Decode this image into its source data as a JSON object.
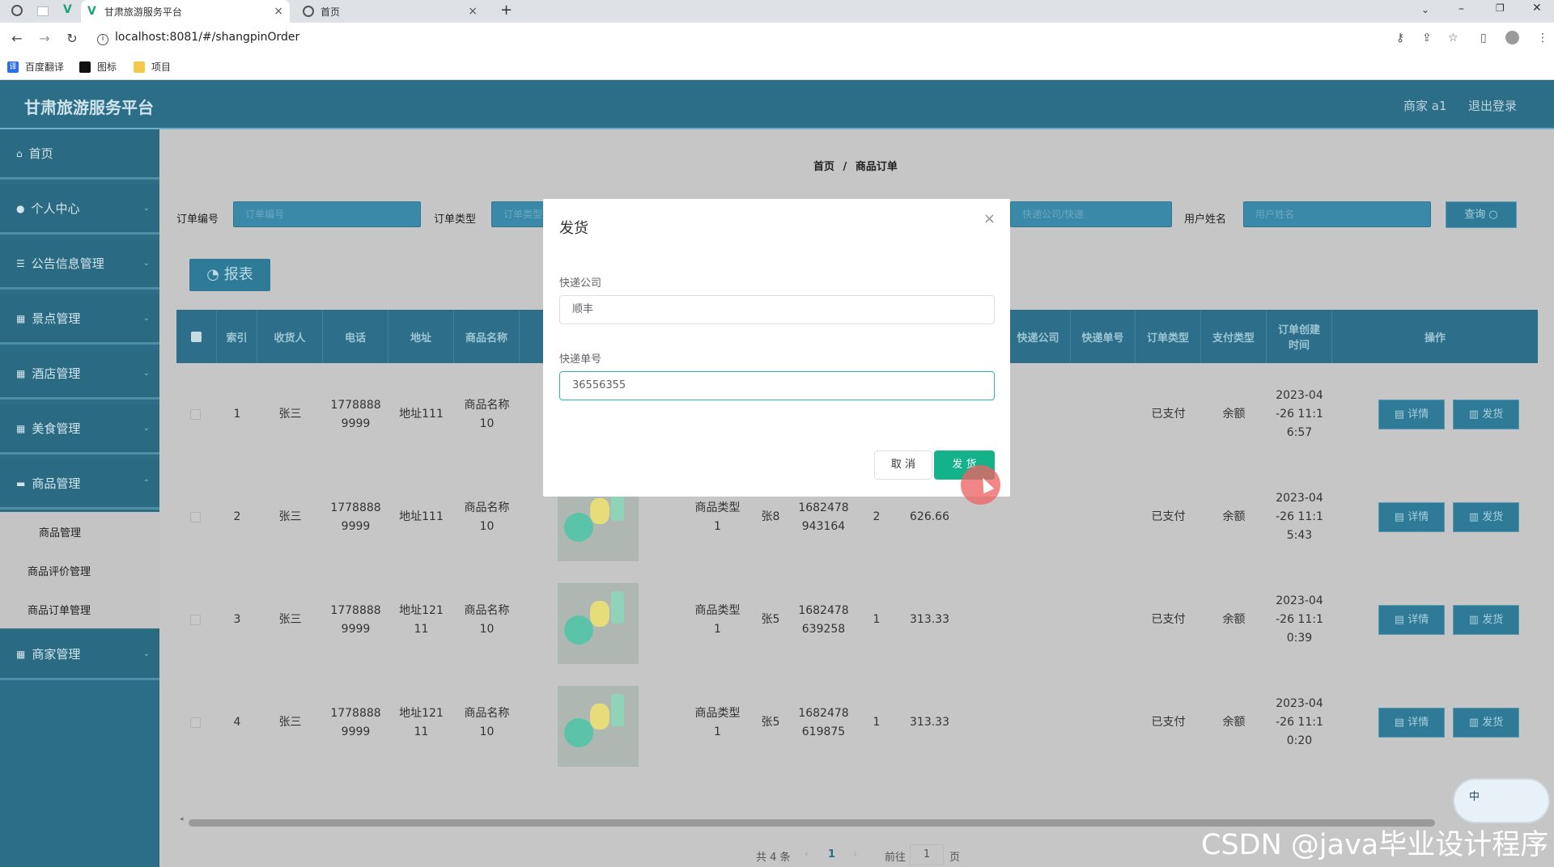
{
  "browser": {
    "tabs": [
      {
        "title": "甘肃旅游服务平台",
        "close": "×"
      },
      {
        "title": "首页",
        "close": "×"
      }
    ],
    "new_tab": "+",
    "url": "localhost:8081/#/shangpinOrder",
    "bookmarks": [
      "百度翻译",
      "图标",
      "项目"
    ]
  },
  "header": {
    "title": "甘肃旅游服务平台",
    "user": "商家 a1",
    "logout": "退出登录"
  },
  "sidebar": {
    "items": [
      {
        "label": "首页",
        "icon": "home-icon"
      },
      {
        "label": "个人中心",
        "icon": "user-icon"
      },
      {
        "label": "公告信息管理",
        "icon": "list-icon"
      },
      {
        "label": "景点管理",
        "icon": "grid-icon"
      },
      {
        "label": "酒店管理",
        "icon": "grid-icon"
      },
      {
        "label": "美食管理",
        "icon": "grid-icon"
      },
      {
        "label": "商品管理",
        "icon": "message-icon"
      }
    ],
    "sub_items": [
      "商品管理",
      "商品评价管理",
      "商品订单管理"
    ],
    "last_item": {
      "label": "商家管理",
      "icon": "grid-icon"
    }
  },
  "main": {
    "breadcrumb": {
      "home": "首页",
      "sep": "/",
      "current": "商品订单"
    },
    "filters": {
      "order_no_label": "订单编号",
      "order_no_placeholder": "订单编号",
      "order_type_label": "订单类型",
      "order_type_placeholder": "订单类型",
      "middle_placeholder": "快递公司/快递",
      "user_name_label": "用户姓名",
      "user_name_placeholder": "用户姓名",
      "query": "查询"
    },
    "report_button": "报表",
    "table": {
      "columns": [
        "索引",
        "收货人",
        "电话",
        "地址",
        "商品名称",
        "",
        "",
        "",
        "",
        "",
        "",
        "快递公司",
        "快递单号",
        "订单类型",
        "支付类型",
        "订单创建时间",
        "操作"
      ],
      "col_header_order_time": "订单创建\n时间",
      "rows": [
        {
          "index": "1",
          "receiver": "张三",
          "phone": "1778888\n9999",
          "address": "地址111",
          "product": "商品名称\n10",
          "ptype": "",
          "seller": "",
          "order_no": "",
          "qty": "",
          "price": "",
          "status": "已支付",
          "pay": "余额",
          "created": "2023-04\n-26 11:1\n6:57"
        },
        {
          "index": "2",
          "receiver": "张三",
          "phone": "1778888\n9999",
          "address": "地址111",
          "product": "商品名称\n10",
          "ptype": "商品类型\n1",
          "seller": "张8",
          "order_no": "1682478\n943164",
          "qty": "2",
          "price": "626.66",
          "status": "已支付",
          "pay": "余额",
          "created": "2023-04\n-26 11:1\n5:43"
        },
        {
          "index": "3",
          "receiver": "张三",
          "phone": "1778888\n9999",
          "address": "地址121\n11",
          "product": "商品名称\n10",
          "ptype": "商品类型\n1",
          "seller": "张5",
          "order_no": "1682478\n639258",
          "qty": "1",
          "price": "313.33",
          "status": "已支付",
          "pay": "余额",
          "created": "2023-04\n-26 11:1\n0:39"
        },
        {
          "index": "4",
          "receiver": "张三",
          "phone": "1778888\n9999",
          "address": "地址121\n11",
          "product": "商品名称\n10",
          "ptype": "商品类型\n1",
          "seller": "张5",
          "order_no": "1682478\n619875",
          "qty": "1",
          "price": "313.33",
          "status": "已支付",
          "pay": "余额",
          "created": "2023-04\n-26 11:1\n0:20"
        }
      ],
      "detail_btn": "详情",
      "ship_btn": "发货"
    },
    "pagination": {
      "total": "共 4 条",
      "current": "1",
      "goto_prefix": "前往",
      "goto_value": "1",
      "goto_suffix": "页"
    }
  },
  "dialog": {
    "title": "发货",
    "close": "×",
    "company_label": "快递公司",
    "company_value": "顺丰",
    "tracking_label": "快递单号",
    "tracking_value": "36556355",
    "cancel": "取 消",
    "confirm": "发 货"
  },
  "ime": "中",
  "watermark": "CSDN @java毕业设计程序"
}
